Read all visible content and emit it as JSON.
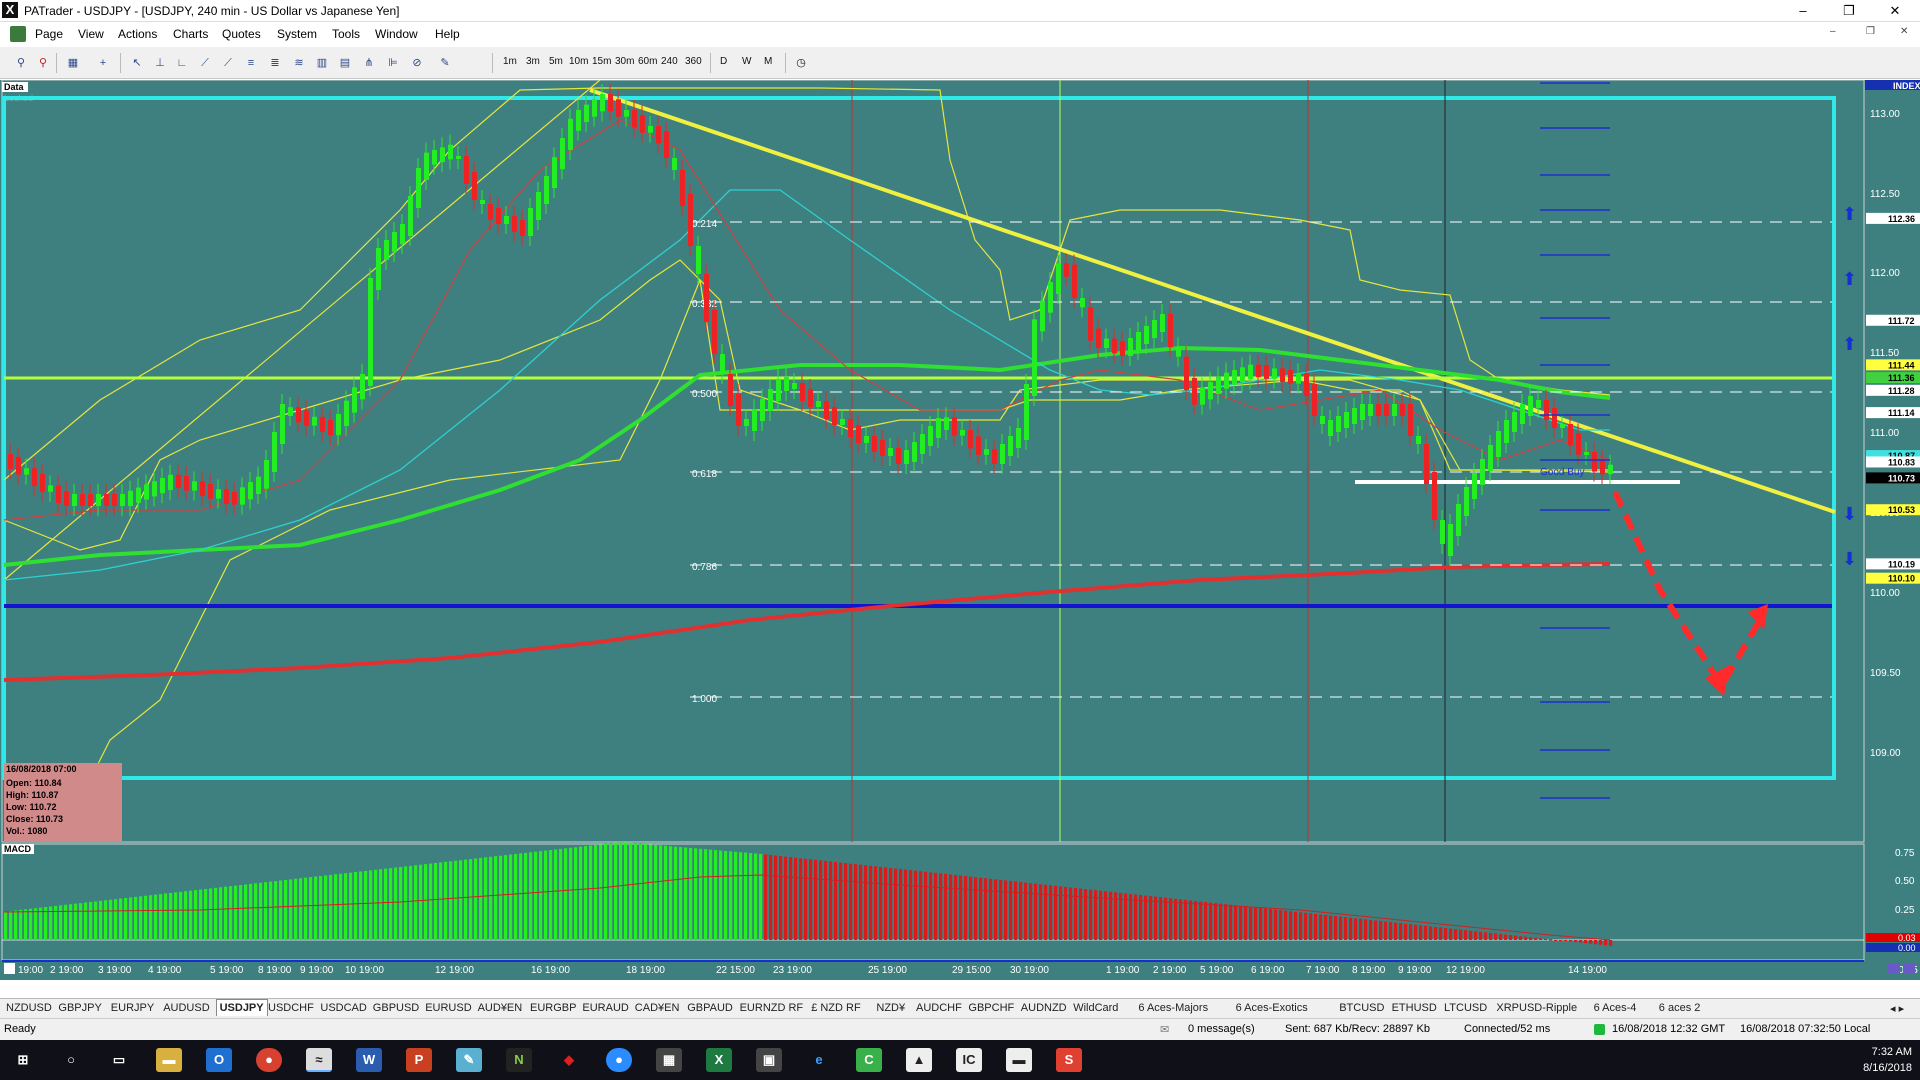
{
  "app": {
    "icon": "X",
    "title": "PATrader - USDJPY - [USDJPY, 240 min - US Dollar vs Japanese Yen]"
  },
  "window_controls": {
    "minimize": "–",
    "restore": "❐",
    "close": "✕",
    "mdi_min": "–",
    "mdi_restore": "❐",
    "mdi_close": "✕"
  },
  "menu": [
    "Page",
    "View",
    "Actions",
    "Charts",
    "Quotes",
    "System",
    "Tools",
    "Window",
    "Help"
  ],
  "timeframes": [
    "1m",
    "3m",
    "5m",
    "10m",
    "15m",
    "30m",
    "60m",
    "240",
    "360",
    "D",
    "W",
    "M"
  ],
  "chart": {
    "corner_labels": {
      "data": "Data",
      "locked": "Locked",
      "index": "INDEX",
      "macd": "MACD"
    },
    "price_ticks": [
      "113.00",
      "112.50",
      "112.00",
      "111.50",
      "111.00",
      "110.50",
      "110.00",
      "109.50",
      "109.00"
    ],
    "price_tags": [
      {
        "value": "112.36",
        "bg": "#ffffff",
        "fg": "#000000"
      },
      {
        "value": "111.72",
        "bg": "#ffffff",
        "fg": "#000000"
      },
      {
        "value": "111.44",
        "bg": "#ffff40",
        "fg": "#000000"
      },
      {
        "value": "111.36",
        "bg": "#40d040",
        "fg": "#000000"
      },
      {
        "value": "111.28",
        "bg": "#ffffff",
        "fg": "#000000"
      },
      {
        "value": "111.14",
        "bg": "#ffffff",
        "fg": "#000000"
      },
      {
        "value": "110.87",
        "bg": "#40e0e0",
        "fg": "#000000"
      },
      {
        "value": "110.83",
        "bg": "#ffffff",
        "fg": "#000000"
      },
      {
        "value": "110.73",
        "bg": "#000000",
        "fg": "#ffffff"
      },
      {
        "value": "110.53",
        "bg": "#ffff40",
        "fg": "#000000"
      },
      {
        "value": "110.19",
        "bg": "#ffffff",
        "fg": "#000000"
      },
      {
        "value": "110.10",
        "bg": "#ffff40",
        "fg": "#000000"
      }
    ],
    "fib_levels": [
      {
        "label": "0.214",
        "price": 112.36
      },
      {
        "label": "0.382",
        "price": 111.72
      },
      {
        "label": "0.500",
        "price": 111.28
      },
      {
        "label": "0.618",
        "price": 110.83
      },
      {
        "label": "0.786",
        "price": 110.19
      },
      {
        "label": "1.000",
        "price": 109.38
      }
    ],
    "bar_info": {
      "date": "16/08/2018 07:00",
      "open": "Open: 110.84",
      "high": "High: 110.87",
      "low": "Low: 110.72",
      "close": "Close: 110.73",
      "vol": "Vol.: 1080"
    },
    "macd_ticks": [
      "0.75",
      "0.50",
      "0.25",
      "0.03",
      "0.00",
      "-0.25"
    ],
    "date_labels": [
      "19:00",
      "2 19:00",
      "3 19:00",
      "4 19:00",
      "5 19:00",
      "8 19:00",
      "9 19:00",
      "10 19:00",
      "12 19:00",
      "16 19:00",
      "18 19:00",
      "22 15:00",
      "23 19:00",
      "25 19:00",
      "29 15:00",
      "30 19:00",
      "1 19:00",
      "2 19:00",
      "5 19:00",
      "6 19:00",
      "7 19:00",
      "8 19:00",
      "9 19:00",
      "12 19:00",
      "14 19:00"
    ],
    "annotation_label": "Good Buy"
  },
  "symbol_tabs": [
    "NZDUSD",
    "GBPJPY",
    "EURJPY",
    "AUDUSD",
    "USDJPY",
    "USDCHF",
    "USDCAD",
    "GBPUSD",
    "EURUSD",
    "AUD¥EN",
    "EURGBP",
    "EURAUD",
    "CAD¥EN",
    "GBPAUD",
    "EURNZD RF",
    "£ NZD RF",
    "NZD¥",
    "AUDCHF",
    "GBPCHF",
    "AUDNZD",
    "WildCard",
    "6 Aces-Majors",
    "6 Aces-Exotics",
    "BTCUSD",
    "ETHUSD",
    "LTCUSD",
    "XRPUSD-Ripple",
    "6 Aces-4",
    "6 aces 2"
  ],
  "active_tab": "USDJPY",
  "status": {
    "ready": "Ready",
    "messages": "0 message(s)",
    "traffic": "Sent: 687 Kb/Recv: 28897 Kb",
    "connected": "Connected/52 ms",
    "gmt": "16/08/2018 12:32 GMT",
    "local": "16/08/2018 07:32:50 Local"
  },
  "taskbar": {
    "time": "7:32 AM",
    "date": "8/16/2018"
  }
}
